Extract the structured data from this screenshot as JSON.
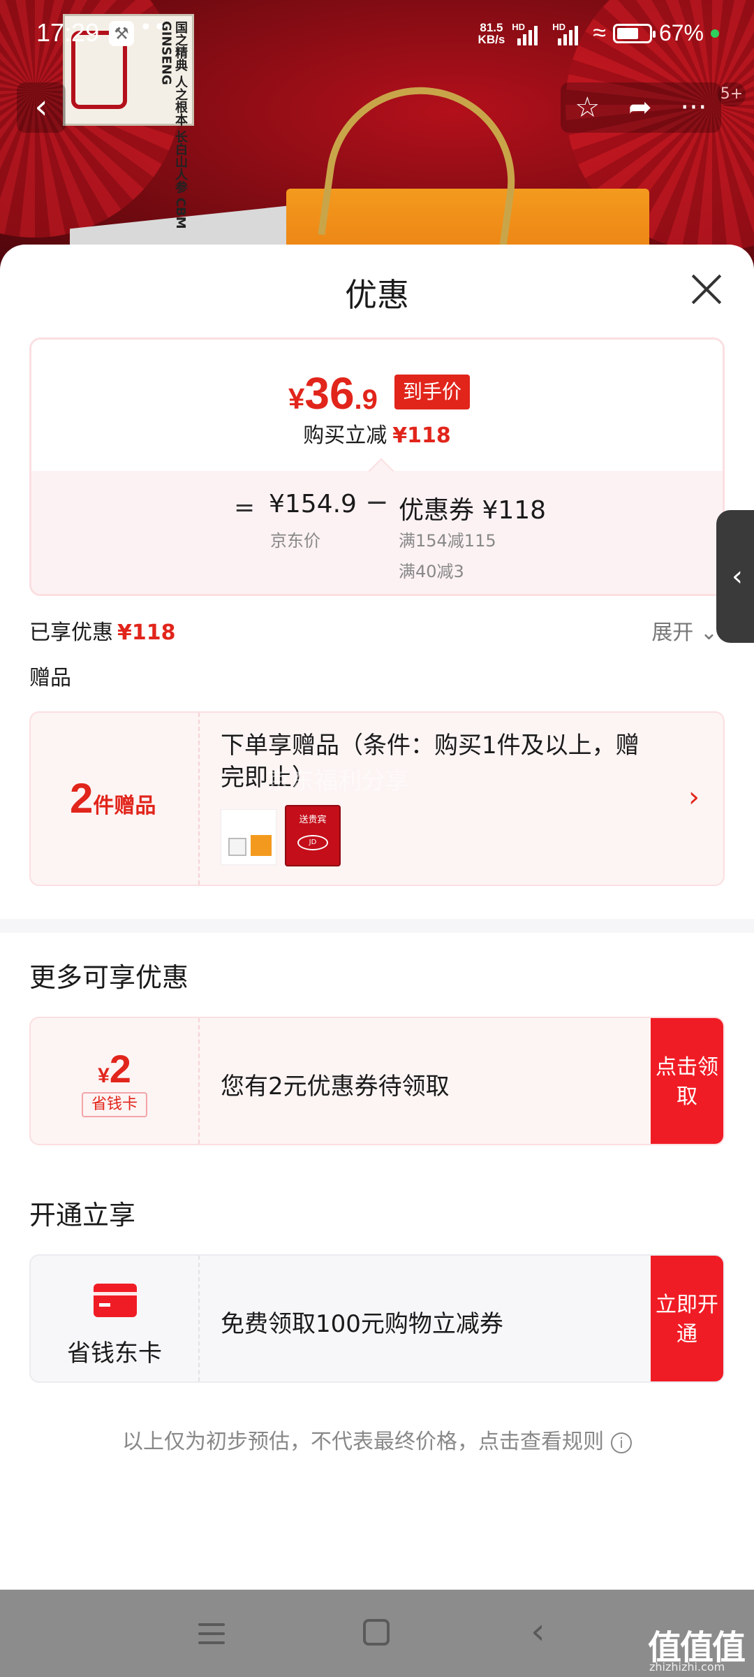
{
  "status_bar": {
    "time": "17:29",
    "network_speed": "81.5",
    "network_unit": "KB/s",
    "signal_tag": "HD",
    "battery": "67%"
  },
  "product_logo_text": "国之精典 人之根本 长白山人参 CBM GINSENG",
  "top_nav": {
    "badge": "5+"
  },
  "sheet": {
    "title": "优惠"
  },
  "price_summary": {
    "final_currency": "¥",
    "final_integer": "36",
    "final_decimal": ".9",
    "final_tag": "到手价",
    "reduce_label": "购买立减",
    "reduce_amount": "¥118",
    "equals": "=",
    "jd_price": "¥154.9",
    "jd_price_label": "京东价",
    "minus": "−",
    "coupon_line": "优惠券 ¥118",
    "coupon_detail_1": "满154减115",
    "coupon_detail_2": "满40减3"
  },
  "enjoyed": {
    "label": "已享优惠",
    "amount": "¥118",
    "expand": "展开"
  },
  "gift": {
    "section_title": "赠品",
    "count": "2",
    "count_unit": "件赠品",
    "description": "下单享赠品（条件：购买1件及以上，赠完即止）",
    "watermark": "京东福利分享",
    "gift2_label": "送贵宾",
    "gift2_seal": "JD"
  },
  "more_offers": {
    "title": "更多可享优惠",
    "currency": "¥",
    "value": "2",
    "tag": "省钱卡",
    "description": "您有2元优惠券待领取",
    "button": "点击领取"
  },
  "open_now": {
    "title": "开通立享",
    "card_name": "省钱东卡",
    "description": "免费领取100元购物立减券",
    "button": "立即开通"
  },
  "disclaimer": "以上仅为初步预估，不代表最终价格，点击查看规则",
  "watermark_brand": {
    "name": "值值值",
    "url": "zhizhizhi.com"
  },
  "colors": {
    "accent": "#e1251b",
    "button_red": "#f01c25",
    "card_bg": "#fdf4f4"
  }
}
